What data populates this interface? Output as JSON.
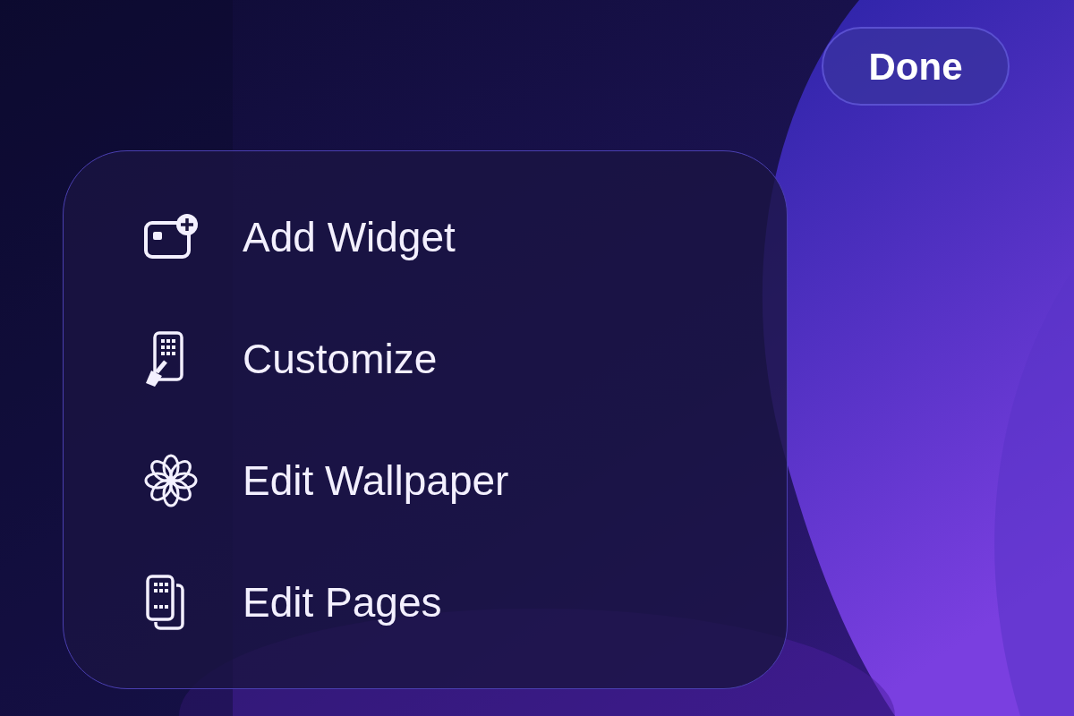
{
  "done_button": {
    "label": "Done"
  },
  "menu": {
    "items": [
      {
        "kind": "add-widget",
        "label": "Add Widget"
      },
      {
        "kind": "customize",
        "label": "Customize"
      },
      {
        "kind": "wallpaper",
        "label": "Edit Wallpaper"
      },
      {
        "kind": "pages",
        "label": "Edit Pages"
      }
    ]
  }
}
